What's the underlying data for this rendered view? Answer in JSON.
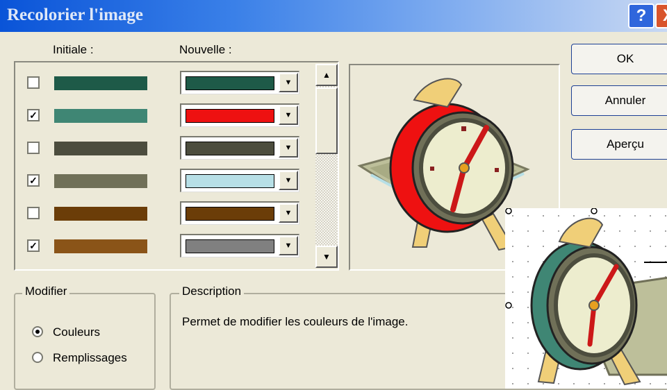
{
  "window": {
    "title": "Recolorier l'image",
    "help_label": "?",
    "close_label": "X"
  },
  "columns": {
    "initial": "Initiale :",
    "new": "Nouvelle :"
  },
  "rows": [
    {
      "checked": false,
      "initial_color": "#1e5a48",
      "new_color": "#1e5a48"
    },
    {
      "checked": true,
      "initial_color": "#3f8674",
      "new_color": "#ee1111"
    },
    {
      "checked": false,
      "initial_color": "#4c4d3e",
      "new_color": "#4c4d3e"
    },
    {
      "checked": true,
      "initial_color": "#707058",
      "new_color": "#b7dfe6"
    },
    {
      "checked": false,
      "initial_color": "#6b3d08",
      "new_color": "#6b3d08"
    },
    {
      "checked": true,
      "initial_color": "#8a5418",
      "new_color": "#808080"
    }
  ],
  "buttons": {
    "ok": "OK",
    "cancel": "Annuler",
    "preview": "Aperçu"
  },
  "modify": {
    "label": "Modifier",
    "options": [
      {
        "label": "Couleurs",
        "selected": true
      },
      {
        "label": "Remplissages",
        "selected": false
      }
    ]
  },
  "description": {
    "label": "Description",
    "text": "Permet de modifier les couleurs de l'image."
  },
  "icons": {
    "check": "✓",
    "scroll_up": "▲",
    "scroll_down": "▼",
    "dropdown": "▼"
  }
}
